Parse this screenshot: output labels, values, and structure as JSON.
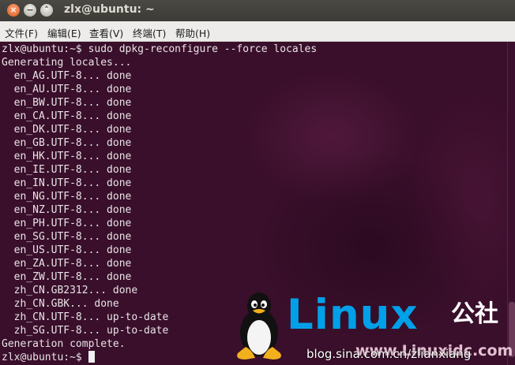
{
  "window": {
    "title": "zlx@ubuntu: ~",
    "buttons": {
      "close": "×",
      "minimize": "−",
      "maximize": "˄"
    }
  },
  "menu": [
    "文件(F)",
    "编辑(E)",
    "查看(V)",
    "终端(T)",
    "帮助(H)"
  ],
  "terminal": {
    "lines": [
      "zlx@ubuntu:~$ sudo dpkg-reconfigure --force locales",
      "Generating locales...",
      "  en_AG.UTF-8... done",
      "  en_AU.UTF-8... done",
      "  en_BW.UTF-8... done",
      "  en_CA.UTF-8... done",
      "  en_DK.UTF-8... done",
      "  en_GB.UTF-8... done",
      "  en_HK.UTF-8... done",
      "  en_IE.UTF-8... done",
      "  en_IN.UTF-8... done",
      "  en_NG.UTF-8... done",
      "  en_NZ.UTF-8... done",
      "  en_PH.UTF-8... done",
      "  en_SG.UTF-8... done",
      "  en_US.UTF-8... done",
      "  en_ZA.UTF-8... done",
      "  en_ZW.UTF-8... done",
      "  zh_CN.GB2312... done",
      "  zh_CN.GBK... done",
      "  zh_CN.UTF-8... up-to-date",
      "  zh_SG.UTF-8... up-to-date",
      "Generation complete."
    ],
    "prompt": "zlx@ubuntu:~$ "
  },
  "watermark": {
    "brand": "Linux",
    "brand_cn": "公社",
    "url": "www.Linuxidc.com",
    "blog": "blog.sina.com.cn/zlianxiang",
    "colors": {
      "brand": "#00a0e9"
    }
  },
  "colors": {
    "terminal_bg": "#3a0f2b",
    "terminal_fg": "#e8e4e6",
    "titlebar": "#3c3b37",
    "close_button": "#e25c1b"
  }
}
